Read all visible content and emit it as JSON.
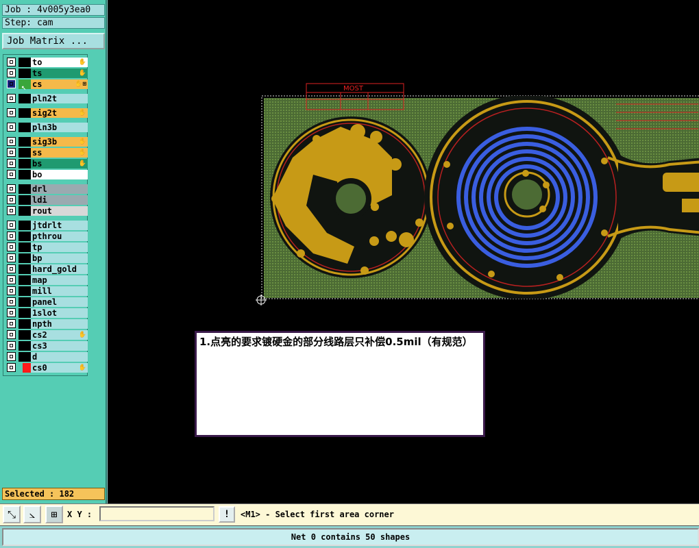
{
  "job": {
    "label": "Job : 4v005y3ea0",
    "step": "Step: cam"
  },
  "matrix_button": "Job Matrix ...",
  "layers": [
    {
      "name": "to",
      "color": "#ffffff",
      "icon": "hand"
    },
    {
      "name": "ts",
      "color": "#1f9a70",
      "icon": "hand"
    },
    {
      "name": "cs",
      "color": "#f5b94a",
      "icon": "hand-grid",
      "active": true
    },
    {
      "name": "pln2t",
      "color": "#a8dfe0",
      "icon": ""
    },
    {
      "name": "sig2t",
      "color": "#f5b94a",
      "icon": "hand"
    },
    {
      "name": "pln3b",
      "color": "#a8dfe0",
      "icon": ""
    },
    {
      "name": "sig3b",
      "color": "#f5b94a",
      "icon": "hand"
    },
    {
      "name": "ss",
      "color": "#f5b94a",
      "icon": "hand"
    },
    {
      "name": "bs",
      "color": "#1f9a70",
      "icon": "hand"
    },
    {
      "name": "bo",
      "color": "#ffffff",
      "icon": ""
    },
    {
      "name": "drl",
      "color": "#9aaab0",
      "icon": ""
    },
    {
      "name": "ldi",
      "color": "#9aaab0",
      "icon": ""
    },
    {
      "name": "rout",
      "color": "#d8d8d8",
      "icon": ""
    },
    {
      "name": "jtdrlt",
      "color": "#a8dfe0",
      "icon": ""
    },
    {
      "name": "pthrou",
      "color": "#a8dfe0",
      "icon": ""
    },
    {
      "name": "tp",
      "color": "#a8dfe0",
      "icon": ""
    },
    {
      "name": "bp",
      "color": "#a8dfe0",
      "icon": ""
    },
    {
      "name": "hard_gold",
      "color": "#a8dfe0",
      "icon": ""
    },
    {
      "name": "map",
      "color": "#a8dfe0",
      "icon": ""
    },
    {
      "name": "mill",
      "color": "#a8dfe0",
      "icon": ""
    },
    {
      "name": "panel",
      "color": "#a8dfe0",
      "icon": ""
    },
    {
      "name": "1slot",
      "color": "#a8dfe0",
      "icon": ""
    },
    {
      "name": "npth",
      "color": "#a8dfe0",
      "icon": ""
    },
    {
      "name": "cs2",
      "color": "#a8dfe0",
      "icon": "hand"
    },
    {
      "name": "cs3",
      "color": "#a8dfe0",
      "icon": ""
    },
    {
      "name": "d",
      "color": "#a8dfe0",
      "icon": ""
    },
    {
      "name": "cs0",
      "color": "#a8dfe0",
      "icon": "hand",
      "marker": "#ff1a1a"
    }
  ],
  "selected": "Selected : 182",
  "toolbar": {
    "xy_label": "X Y :",
    "xy_value": "",
    "bang": "!",
    "prompt": "<M1> - Select first area corner"
  },
  "status": "Net 0 contains 50 shapes",
  "note": "1.点亮的要求镀硬金的部分线路层只补偿0.5mil（有规范）",
  "title_block": {
    "title": "MOST"
  }
}
